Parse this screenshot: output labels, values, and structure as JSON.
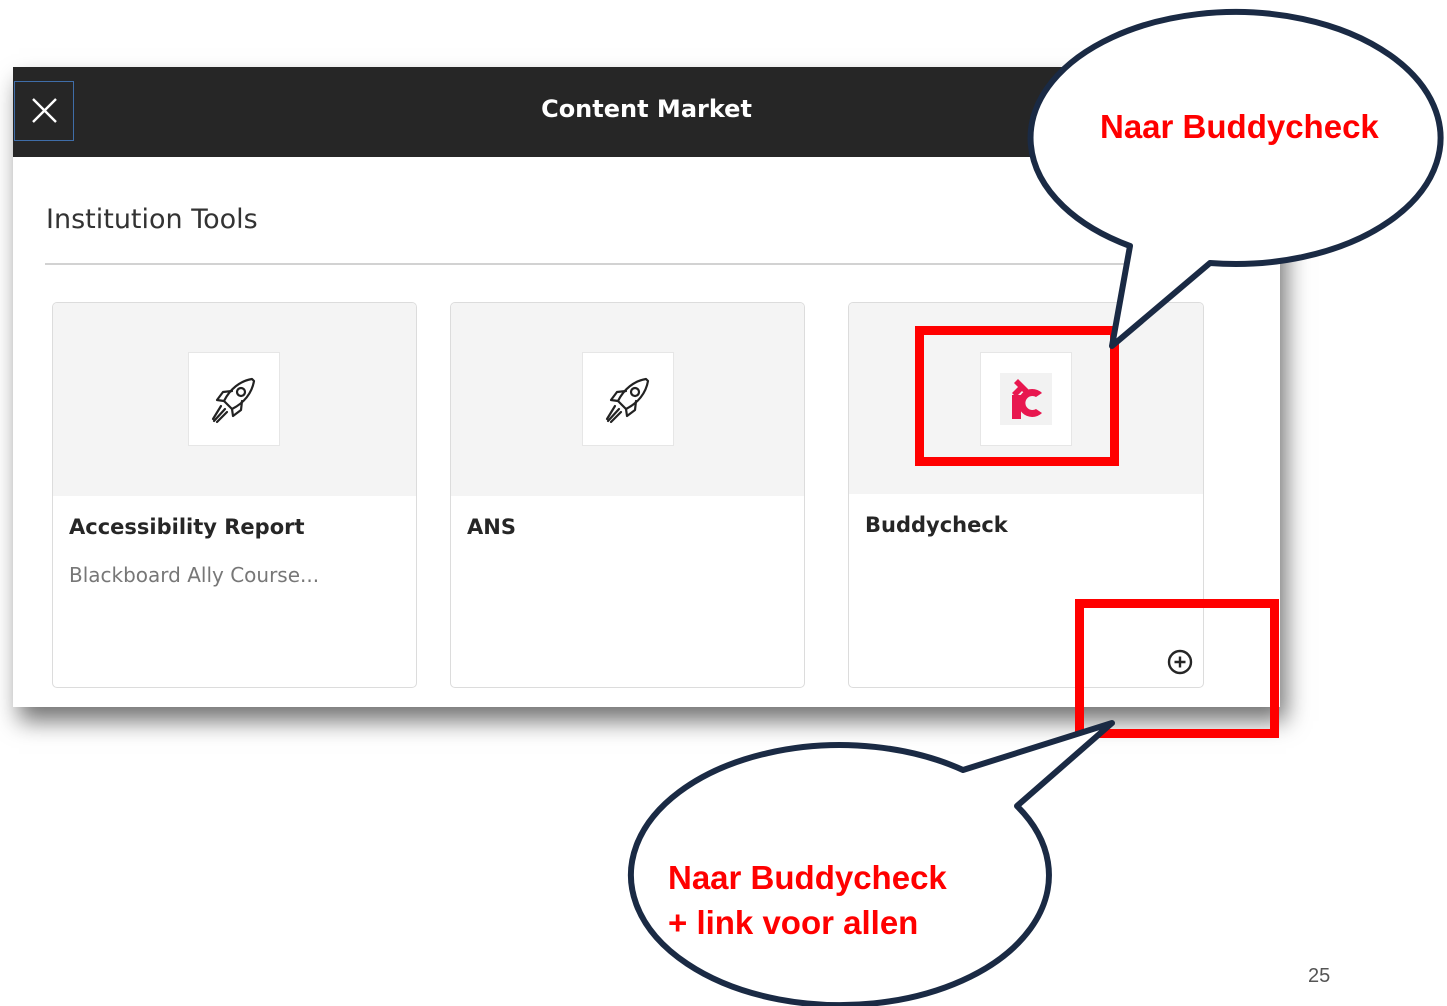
{
  "header": {
    "title": "Content Market",
    "close_icon": "close-icon"
  },
  "section": {
    "title": "Institution Tools"
  },
  "cards": [
    {
      "name": "Accessibility Report",
      "description": "Blackboard Ally Course...",
      "icon": "rocket-icon"
    },
    {
      "name": "ANS",
      "description": "",
      "icon": "rocket-icon"
    },
    {
      "name": "Buddycheck",
      "description": "",
      "icon": "buddycheck-logo"
    }
  ],
  "add_button_icon": "plus-circle-icon",
  "annotations": {
    "callout_top": "Naar Buddycheck",
    "callout_bottom_line1": "Naar Buddycheck",
    "callout_bottom_line2": "+ link voor allen",
    "highlight_color": "#ff0000",
    "callout_outline_color": "#1a2a44"
  },
  "slide_number": "25",
  "colors": {
    "header_bg": "#262626",
    "card_top_bg": "#f4f4f4",
    "logo_color": "#e8174f"
  }
}
